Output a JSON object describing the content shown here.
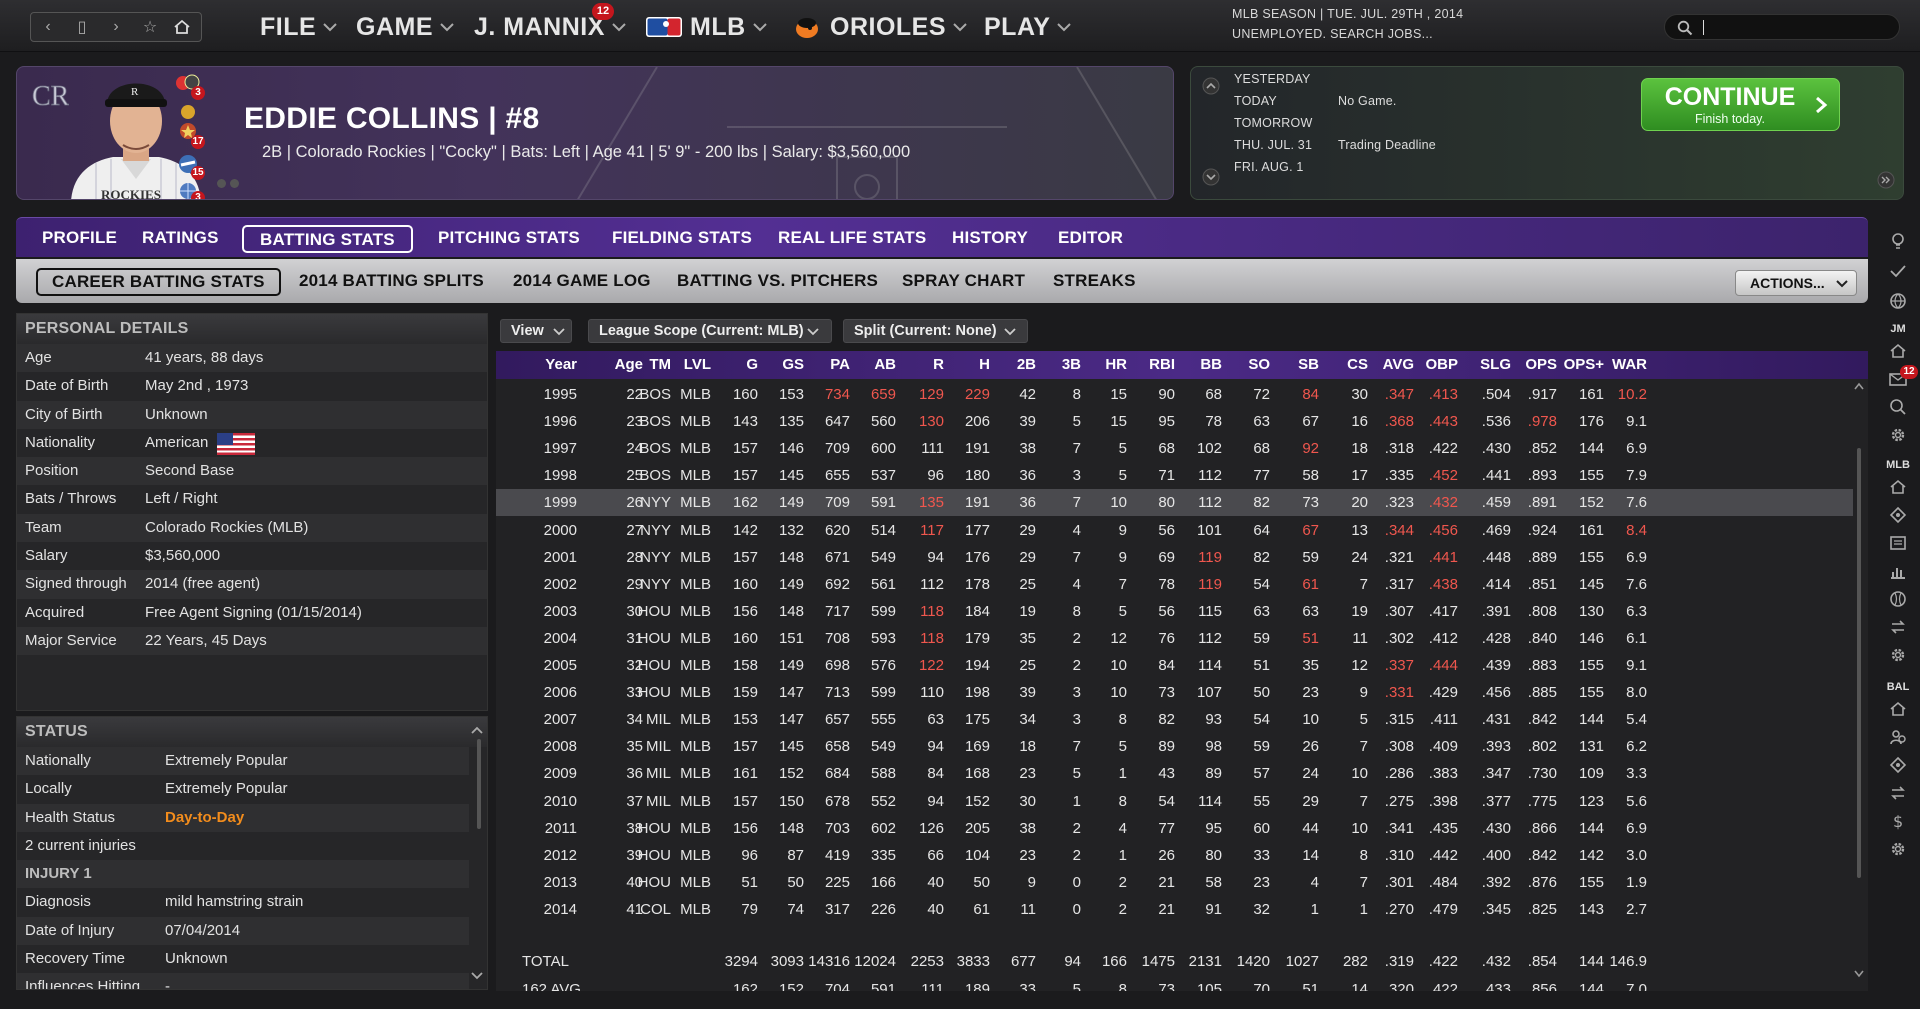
{
  "topbar": {
    "menus": [
      "FILE",
      "GAME",
      "J. MANNIX",
      "MLB",
      "ORIOLES",
      "PLAY"
    ],
    "mannix_badge": "12",
    "season_line1": "MLB SEASON  |  TUE. JUL. 29TH , 2014",
    "season_line2": "UNEMPLOYED. SEARCH JOBS..."
  },
  "player": {
    "name": "EDDIE COLLINS  |  #8",
    "info": "2B | Colorado Rockies  |  \"Cocky\" | Bats: Left  |  Age 41  |  5' 9\" - 200 lbs  |  Salary: $3,560,000",
    "badges": [
      "3",
      "17",
      "15",
      "3"
    ]
  },
  "schedule": {
    "rows": [
      {
        "day": "YESTERDAY",
        "event": ""
      },
      {
        "day": "TODAY",
        "event": "No Game."
      },
      {
        "day": "TOMORROW",
        "event": ""
      },
      {
        "day": "THU. JUL. 31",
        "event": "Trading Deadline"
      },
      {
        "day": "FRI. AUG. 1",
        "event": ""
      }
    ],
    "continue_label": "CONTINUE",
    "continue_sub": "Finish today."
  },
  "tabs": [
    "PROFILE",
    "RATINGS",
    "BATTING STATS",
    "PITCHING STATS",
    "FIELDING STATS",
    "REAL LIFE STATS",
    "HISTORY",
    "EDITOR"
  ],
  "subtabs": [
    "CAREER BATTING STATS",
    "2014 BATTING SPLITS",
    "2014 GAME LOG",
    "BATTING VS. PITCHERS",
    "SPRAY CHART",
    "STREAKS"
  ],
  "actions_label": "ACTIONS...",
  "personal": {
    "title": "PERSONAL DETAILS",
    "rows": [
      {
        "k": "Age",
        "v": "41 years, 88 days"
      },
      {
        "k": "Date of Birth",
        "v": "May 2nd , 1973"
      },
      {
        "k": "City of Birth",
        "v": "Unknown"
      },
      {
        "k": "Nationality",
        "v": "American"
      },
      {
        "k": "Position",
        "v": "Second Base"
      },
      {
        "k": "Bats / Throws",
        "v": "Left / Right"
      },
      {
        "k": "Team",
        "v": "Colorado Rockies (MLB)"
      },
      {
        "k": "Salary",
        "v": "$3,560,000"
      },
      {
        "k": "Signed through",
        "v": "2014 (free agent)"
      },
      {
        "k": "Acquired",
        "v": "Free Agent Signing (01/15/2014)"
      },
      {
        "k": "Major Service",
        "v": "22 Years, 45 Days"
      }
    ]
  },
  "status": {
    "title": "STATUS",
    "rows": [
      {
        "k": "Nationally",
        "v": "Extremely Popular"
      },
      {
        "k": "Locally",
        "v": "Extremely Popular"
      },
      {
        "k": "Health Status",
        "v": "Day-to-Day"
      },
      {
        "k": "2 current injuries",
        "v": ""
      },
      {
        "k": "INJURY 1",
        "v": ""
      },
      {
        "k": "Diagnosis",
        "v": "mild hamstring strain"
      },
      {
        "k": "Date of Injury",
        "v": "07/04/2014"
      },
      {
        "k": "Recovery Time",
        "v": "Unknown"
      },
      {
        "k": "Influences Hitting",
        "v": "-"
      }
    ]
  },
  "filters": {
    "view": "View",
    "scope": "League Scope (Current: MLB)",
    "split": "Split  (Current: None)"
  },
  "table": {
    "columns": [
      "Year",
      "Age",
      "TM",
      "LVL",
      "G",
      "GS",
      "PA",
      "AB",
      "R",
      "H",
      "2B",
      "3B",
      "HR",
      "RBI",
      "BB",
      "SO",
      "SB",
      "CS",
      "AVG",
      "OBP",
      "SLG",
      "OPS",
      "OPS+",
      "WAR"
    ],
    "rows": [
      [
        "1995",
        "22",
        "BOS",
        "MLB",
        "160",
        "153",
        "734",
        "659",
        "129",
        "229",
        "42",
        "8",
        "15",
        "90",
        "68",
        "72",
        "84",
        "30",
        ".347",
        ".413",
        ".504",
        ".917",
        "161",
        "10.2"
      ],
      [
        "1996",
        "23",
        "BOS",
        "MLB",
        "143",
        "135",
        "647",
        "560",
        "130",
        "206",
        "39",
        "5",
        "15",
        "95",
        "78",
        "63",
        "67",
        "16",
        ".368",
        ".443",
        ".536",
        ".978",
        "176",
        "9.1"
      ],
      [
        "1997",
        "24",
        "BOS",
        "MLB",
        "157",
        "146",
        "709",
        "600",
        "111",
        "191",
        "38",
        "7",
        "5",
        "68",
        "102",
        "68",
        "92",
        "18",
        ".318",
        ".422",
        ".430",
        ".852",
        "144",
        "6.9"
      ],
      [
        "1998",
        "25",
        "BOS",
        "MLB",
        "157",
        "145",
        "655",
        "537",
        "96",
        "180",
        "36",
        "3",
        "5",
        "71",
        "112",
        "77",
        "58",
        "17",
        ".335",
        ".452",
        ".441",
        ".893",
        "155",
        "7.9"
      ],
      [
        "1999",
        "26",
        "NYY",
        "MLB",
        "162",
        "149",
        "709",
        "591",
        "135",
        "191",
        "36",
        "7",
        "10",
        "80",
        "112",
        "82",
        "73",
        "20",
        ".323",
        ".432",
        ".459",
        ".891",
        "152",
        "7.6"
      ],
      [
        "2000",
        "27",
        "NYY",
        "MLB",
        "142",
        "132",
        "620",
        "514",
        "117",
        "177",
        "29",
        "4",
        "9",
        "56",
        "101",
        "64",
        "67",
        "13",
        ".344",
        ".456",
        ".469",
        ".924",
        "161",
        "8.4"
      ],
      [
        "2001",
        "28",
        "NYY",
        "MLB",
        "157",
        "148",
        "671",
        "549",
        "94",
        "176",
        "29",
        "7",
        "9",
        "69",
        "119",
        "82",
        "59",
        "24",
        ".321",
        ".441",
        ".448",
        ".889",
        "155",
        "6.9"
      ],
      [
        "2002",
        "29",
        "NYY",
        "MLB",
        "160",
        "149",
        "692",
        "561",
        "112",
        "178",
        "25",
        "4",
        "7",
        "78",
        "119",
        "54",
        "61",
        "7",
        ".317",
        ".438",
        ".414",
        ".851",
        "145",
        "7.6"
      ],
      [
        "2003",
        "30",
        "HOU",
        "MLB",
        "156",
        "148",
        "717",
        "599",
        "118",
        "184",
        "19",
        "8",
        "5",
        "56",
        "115",
        "63",
        "63",
        "19",
        ".307",
        ".417",
        ".391",
        ".808",
        "130",
        "6.3"
      ],
      [
        "2004",
        "31",
        "HOU",
        "MLB",
        "160",
        "151",
        "708",
        "593",
        "118",
        "179",
        "35",
        "2",
        "12",
        "76",
        "112",
        "59",
        "51",
        "11",
        ".302",
        ".412",
        ".428",
        ".840",
        "146",
        "6.1"
      ],
      [
        "2005",
        "32",
        "HOU",
        "MLB",
        "158",
        "149",
        "698",
        "576",
        "122",
        "194",
        "25",
        "2",
        "10",
        "84",
        "114",
        "51",
        "35",
        "12",
        ".337",
        ".444",
        ".439",
        ".883",
        "155",
        "9.1"
      ],
      [
        "2006",
        "33",
        "HOU",
        "MLB",
        "159",
        "147",
        "713",
        "599",
        "110",
        "198",
        "39",
        "3",
        "10",
        "73",
        "107",
        "50",
        "23",
        "9",
        ".331",
        ".429",
        ".456",
        ".885",
        "155",
        "8.0"
      ],
      [
        "2007",
        "34",
        "MIL",
        "MLB",
        "153",
        "147",
        "657",
        "555",
        "63",
        "175",
        "34",
        "3",
        "8",
        "82",
        "93",
        "54",
        "10",
        "5",
        ".315",
        ".411",
        ".431",
        ".842",
        "144",
        "5.4"
      ],
      [
        "2008",
        "35",
        "MIL",
        "MLB",
        "157",
        "145",
        "658",
        "549",
        "94",
        "169",
        "18",
        "7",
        "5",
        "89",
        "98",
        "59",
        "26",
        "7",
        ".308",
        ".409",
        ".393",
        ".802",
        "131",
        "6.2"
      ],
      [
        "2009",
        "36",
        "MIL",
        "MLB",
        "161",
        "152",
        "684",
        "588",
        "84",
        "168",
        "23",
        "5",
        "1",
        "43",
        "89",
        "57",
        "24",
        "10",
        ".286",
        ".383",
        ".347",
        ".730",
        "109",
        "3.3"
      ],
      [
        "2010",
        "37",
        "MIL",
        "MLB",
        "157",
        "150",
        "678",
        "552",
        "94",
        "152",
        "30",
        "1",
        "8",
        "54",
        "114",
        "55",
        "29",
        "7",
        ".275",
        ".398",
        ".377",
        ".775",
        "123",
        "5.6"
      ],
      [
        "2011",
        "38",
        "HOU",
        "MLB",
        "156",
        "148",
        "703",
        "602",
        "126",
        "205",
        "38",
        "2",
        "4",
        "77",
        "95",
        "60",
        "44",
        "10",
        ".341",
        ".435",
        ".430",
        ".866",
        "144",
        "6.9"
      ],
      [
        "2012",
        "39",
        "HOU",
        "MLB",
        "96",
        "87",
        "419",
        "335",
        "66",
        "104",
        "23",
        "2",
        "1",
        "26",
        "80",
        "33",
        "14",
        "8",
        ".310",
        ".442",
        ".400",
        ".842",
        "142",
        "3.0"
      ],
      [
        "2013",
        "40",
        "HOU",
        "MLB",
        "51",
        "50",
        "225",
        "166",
        "40",
        "50",
        "9",
        "0",
        "2",
        "21",
        "58",
        "23",
        "4",
        "7",
        ".301",
        ".484",
        ".392",
        ".876",
        "155",
        "1.9"
      ],
      [
        "2014",
        "41",
        "COL",
        "MLB",
        "79",
        "74",
        "317",
        "226",
        "40",
        "61",
        "11",
        "0",
        "2",
        "21",
        "91",
        "32",
        "1",
        "1",
        ".270",
        ".479",
        ".345",
        ".825",
        "143",
        "2.7"
      ]
    ],
    "red_cells": {
      "0": [
        6,
        7,
        8,
        9,
        16,
        18,
        19,
        23
      ],
      "1": [
        8,
        18,
        19,
        21
      ],
      "2": [
        16
      ],
      "3": [
        19
      ],
      "4": [
        8,
        19
      ],
      "5": [
        8,
        16,
        18,
        19,
        23
      ],
      "6": [
        14,
        19
      ],
      "7": [
        14,
        16,
        19
      ],
      "8": [
        8
      ],
      "9": [
        8,
        16
      ],
      "10": [
        8,
        18,
        19
      ],
      "11": [
        18
      ]
    },
    "highlight_row": 4,
    "total": [
      "TOTAL",
      "",
      "",
      "",
      "3294",
      "3093",
      "14316",
      "12024",
      "2253",
      "3833",
      "677",
      "94",
      "166",
      "1475",
      "2131",
      "1420",
      "1027",
      "282",
      ".319",
      ".422",
      ".432",
      ".854",
      "144",
      "146.9"
    ],
    "avg": [
      "162 AVG",
      "",
      "",
      "",
      "162",
      "152",
      "704",
      "591",
      "111",
      "189",
      "33",
      "5",
      "8",
      "73",
      "105",
      "70",
      "51",
      "14",
      ".320",
      ".422",
      ".433",
      ".856",
      "144",
      "7.0"
    ]
  },
  "rail": {
    "jm_label": "JM",
    "mail_badge": "12",
    "mlb_label": "MLB",
    "bal_label": "BAL"
  }
}
